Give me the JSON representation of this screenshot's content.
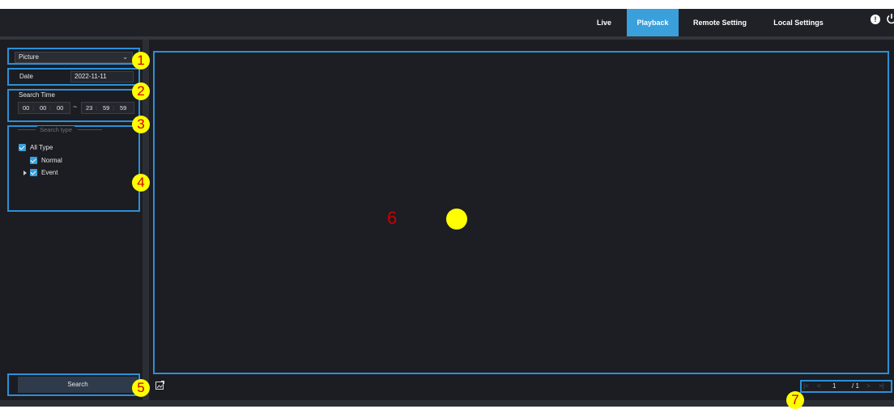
{
  "nav": {
    "live": "Live",
    "playback": "Playback",
    "remote_setting": "Remote Setting",
    "local_settings": "Local Settings",
    "active": "Playback"
  },
  "search_panel": {
    "type_select": "Picture",
    "date_label": "Date",
    "date_value": "2022-11-11",
    "search_time_label": "Search Time",
    "start_time": {
      "hh": "00",
      "mm": "00",
      "ss": "00"
    },
    "end_time": {
      "hh": "23",
      "mm": "59",
      "ss": "59"
    },
    "time_separator": "~",
    "search_type_title": "Search type",
    "types": [
      {
        "label": "All Type",
        "checked": true
      },
      {
        "label": "Normal",
        "checked": true
      },
      {
        "label": "Event",
        "checked": true
      }
    ],
    "search_button": "Search"
  },
  "annotations": {
    "badges": [
      "1",
      "2",
      "3",
      "4",
      "5",
      "7"
    ],
    "main_label": "6"
  },
  "pager": {
    "current_page": "1",
    "total_pages": "/ 1",
    "first": "|<",
    "prev": "<",
    "next": ">",
    "last": ">|"
  },
  "icons": {
    "info": "info-icon",
    "power": "power-icon",
    "export": "export-image-icon",
    "chevron": "chevron-down-icon"
  },
  "colors": {
    "accent": "#3aa0dc",
    "outline": "#2d8fd6",
    "badge_fill": "#ffff00",
    "badge_text": "#cc0000",
    "panel_bg": "#1b1d22"
  }
}
